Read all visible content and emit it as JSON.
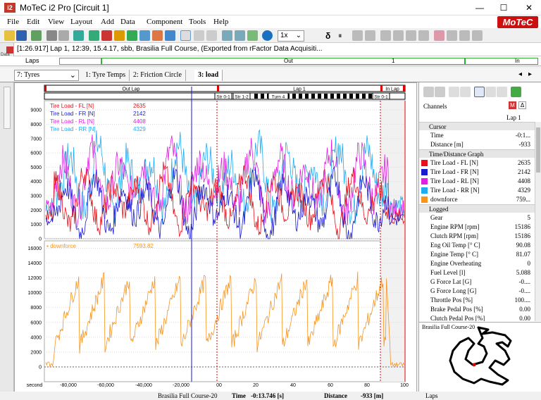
{
  "window": {
    "icon": "i2",
    "title": "MoTeC i2 Pro [Circuit 1]",
    "minimize": "—",
    "maximize": "☐",
    "close": "✕"
  },
  "menu": [
    "File",
    "Edit",
    "View",
    "Layout",
    "Add",
    "Data",
    "Component",
    "Tools",
    "Help"
  ],
  "brand": "MoTeC",
  "toolbar": {
    "zoom": "1x",
    "delta": "δ"
  },
  "infobar": {
    "text": "[1:26.917] Lap 1, 12:39, 15.4.17, sbb, Brasilia Full Course, (Exported from rFactor Data Acquisiti...",
    "side_label": "Data"
  },
  "laps_bar": {
    "label": "Laps",
    "out": "Out",
    "lap1": "1",
    "in": "In"
  },
  "tabs": {
    "selector": "7: Tyres",
    "items": [
      "1: Tyre Temps",
      "2: Friction Circle",
      "3: load"
    ],
    "active": "3: load"
  },
  "graph": {
    "segments": [
      "Out Lap",
      "Lap 1",
      "In Lap"
    ],
    "sectors": [
      "Str 0-1",
      "Str 1-2",
      "Turn 4",
      "Str 0-1"
    ],
    "x_label": "second",
    "x_ticks": [
      "-80,000",
      "-60,000",
      "-40,000",
      "-20,000",
      "00",
      "20",
      "40",
      "60",
      "80",
      "100"
    ]
  },
  "chart_data": [
    {
      "type": "line",
      "xlabel": "second",
      "xlim": [
        -100000,
        100
      ],
      "y_ticks": [
        0,
        1000,
        2000,
        3000,
        4000,
        5000,
        6000,
        7000,
        8000,
        9000
      ],
      "ylim": [
        0,
        9500
      ],
      "series": [
        {
          "name": "Tire Load - FL [N]",
          "cursor_value": "2635",
          "color": "#e8101a"
        },
        {
          "name": "Tire Load - FR [N]",
          "cursor_value": "2142",
          "color": "#1a1ad0"
        },
        {
          "name": "Tire Load - RL [N]",
          "cursor_value": "4408",
          "color": "#e020e0"
        },
        {
          "name": "Tire Load - RR [N]",
          "cursor_value": "4329",
          "color": "#22aaf0"
        }
      ]
    },
    {
      "type": "line",
      "xlabel": "second",
      "y_ticks": [
        0,
        2000,
        4000,
        6000,
        8000,
        10000,
        12000,
        14000,
        16000
      ],
      "ylim": [
        -2000,
        17000
      ],
      "series": [
        {
          "name": "downforce",
          "cursor_value": "7593.82",
          "color": "#f7941d"
        }
      ]
    }
  ],
  "channels": {
    "title": "Channels",
    "lap": "Lap 1",
    "cursor_section": "Cursor",
    "cursor": [
      {
        "name": "Time",
        "value": "-0:1..."
      },
      {
        "name": "Distance [m]",
        "value": "-933"
      }
    ],
    "tdg_section": "Time/Distance Graph",
    "tdg": [
      {
        "name": "Tire Load - FL [N]",
        "value": "2635",
        "color": "#e8101a"
      },
      {
        "name": "Tire Load - FR [N]",
        "value": "2142",
        "color": "#1a1ad0"
      },
      {
        "name": "Tire Load - RL [N]",
        "value": "4408",
        "color": "#e020e0"
      },
      {
        "name": "Tire Load - RR [N]",
        "value": "4329",
        "color": "#22aaf0"
      },
      {
        "name": "downforce",
        "value": "759...",
        "color": "#f7941d"
      }
    ],
    "logged_section": "Logged",
    "logged": [
      {
        "name": "Gear",
        "value": "5"
      },
      {
        "name": "Engine RPM [rpm]",
        "value": "15186"
      },
      {
        "name": "Clutch RPM [rpm]",
        "value": "15186"
      },
      {
        "name": "Eng Oil Temp [° C]",
        "value": "90.08"
      },
      {
        "name": "Engine Temp [° C]",
        "value": "81.07"
      },
      {
        "name": "Engine Overheating",
        "value": "0"
      },
      {
        "name": "Fuel Level [l]",
        "value": "5.088"
      },
      {
        "name": "G Force Lat [G]",
        "value": "-0...."
      },
      {
        "name": "G Force Long [G]",
        "value": "-0...."
      },
      {
        "name": "Throttle Pos [%]",
        "value": "100...."
      },
      {
        "name": "Brake Pedal Pos [%]",
        "value": "0.00"
      },
      {
        "name": "Clutch Pedal Pos [%]",
        "value": "0.00"
      }
    ]
  },
  "track_map": {
    "title": "Brasilia Full Course-20"
  },
  "status": {
    "track": "Brasilia Full Course-20",
    "time_label": "Time",
    "time_value": "-0:13.746 [s]",
    "distance_label": "Distance",
    "distance_value": "-933 [m]",
    "laps": "Laps"
  }
}
